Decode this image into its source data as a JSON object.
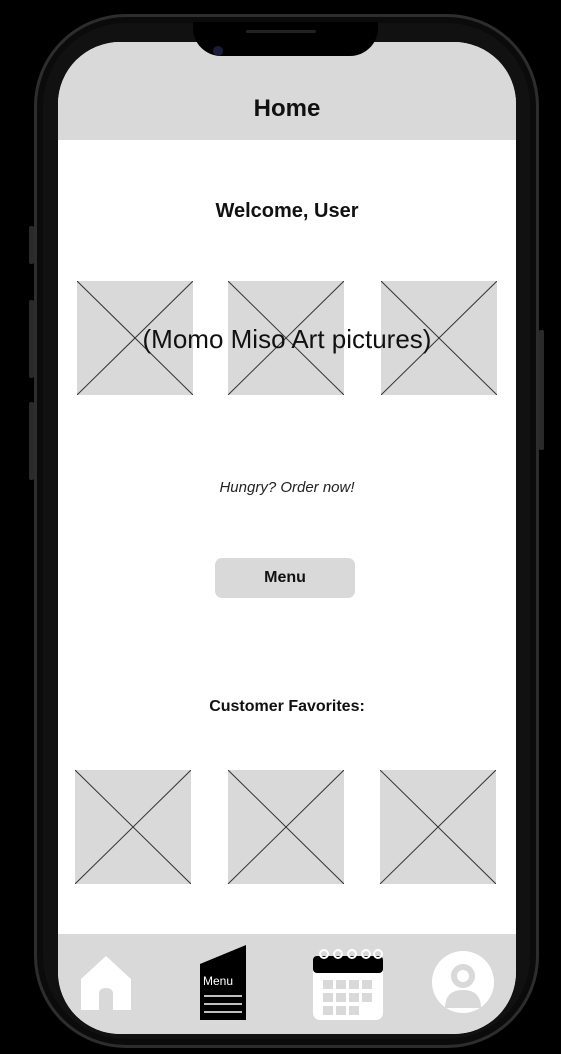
{
  "header": {
    "title": "Home"
  },
  "welcome": {
    "text": "Welcome, User"
  },
  "art_gallery": {
    "caption": "(Momo Miso Art pictures)",
    "placeholder_count": 3
  },
  "promo": {
    "text": "Hungry? Order now!"
  },
  "menu_button": {
    "label": "Menu"
  },
  "favorites": {
    "heading": "Customer Favorites:",
    "placeholder_count": 3
  },
  "tabbar": {
    "items": [
      {
        "icon": "home-icon"
      },
      {
        "icon": "menu-icon",
        "label": "Menu"
      },
      {
        "icon": "calendar-icon"
      },
      {
        "icon": "profile-icon"
      }
    ]
  },
  "colors": {
    "panel": "#d9d9d9",
    "icon": "#ffffff",
    "frame": "#000000"
  }
}
